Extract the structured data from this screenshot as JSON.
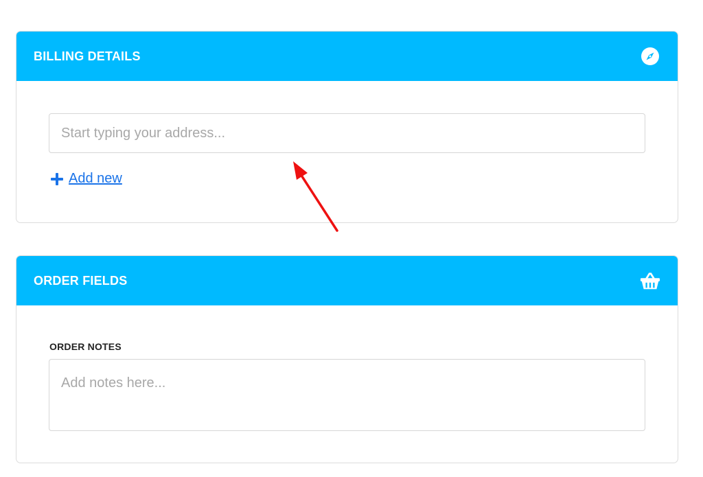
{
  "billing": {
    "title": "BILLING DETAILS",
    "header_icon": "compass-icon",
    "address_placeholder": "Start typing your address...",
    "address_value": "",
    "add_new_label": "Add new",
    "add_new_icon": "plus-icon"
  },
  "order": {
    "title": "ORDER FIELDS",
    "header_icon": "basket-icon",
    "notes_label": "ORDER NOTES",
    "notes_placeholder": "Add notes here...",
    "notes_value": ""
  },
  "colors": {
    "header_bg": "#00baff",
    "link": "#1a73e8",
    "annotation_arrow": "#ee1111"
  }
}
